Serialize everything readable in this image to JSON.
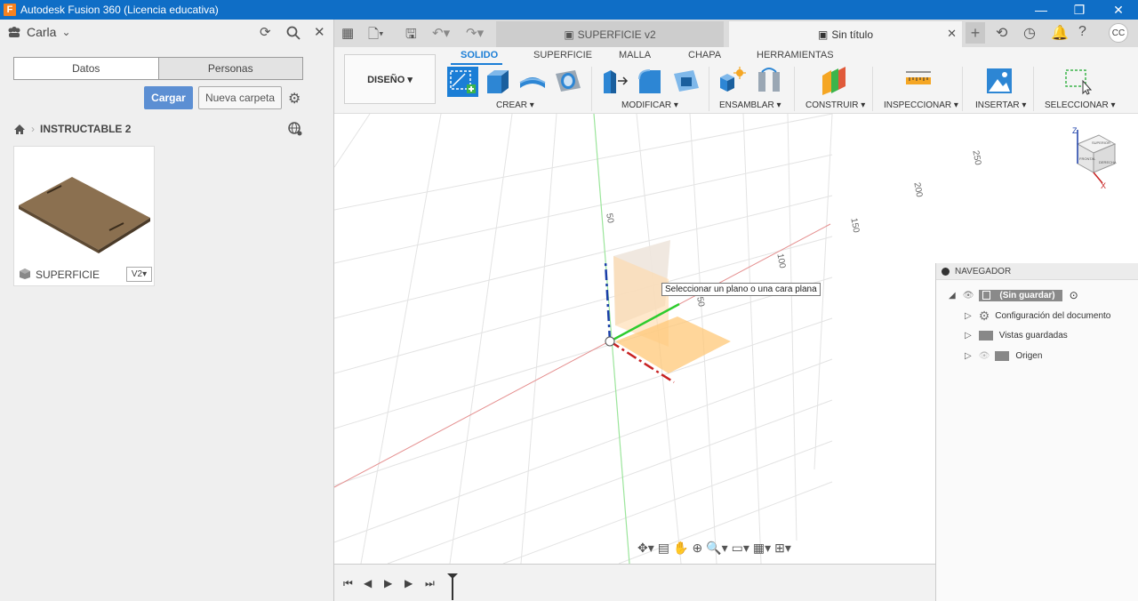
{
  "window": {
    "title": "Autodesk Fusion 360 (Licencia educativa)",
    "minimize": "—",
    "restore": "❐",
    "close": "✕"
  },
  "left_panel": {
    "user": "Carla",
    "tabs": {
      "data": "Datos",
      "people": "Personas"
    },
    "upload_label": "Cargar",
    "new_folder_label": "Nueva carpeta",
    "breadcrumb": "INSTRUCTABLE 2",
    "card": {
      "name": "SUPERFICIE",
      "version": "V2▾"
    }
  },
  "doc_tabs": [
    {
      "label": "SUPERFICIE v2"
    },
    {
      "label": "Sin título"
    }
  ],
  "avatar_initials": "CC",
  "ribbon": {
    "workspace": "DISEÑO ▾",
    "tabs": [
      "SOLIDO",
      "SUPERFICIE",
      "MALLA",
      "CHAPA",
      "HERRAMIENTAS"
    ],
    "groups": [
      "CREAR ▾",
      "MODIFICAR ▾",
      "ENSAMBLAR ▾",
      "CONSTRUIR ▾",
      "INSPECCIONAR ▾",
      "INSERTAR ▾",
      "SELECCIONAR ▾"
    ]
  },
  "viewport": {
    "tooltip": "Seleccionar un plano o una cara plana",
    "grid_labels": [
      "50",
      "100",
      "50",
      "150",
      "200",
      "250"
    ],
    "viewcube": {
      "front": "FRONTAL",
      "right": "DERECHA",
      "top": "SUPERIOR",
      "axis_z": "Z",
      "axis_x": "X"
    }
  },
  "navigator": {
    "title": "NAVEGADOR",
    "root": "(Sin guardar)",
    "items": [
      {
        "label": "Configuración del documento"
      },
      {
        "label": "Vistas guardadas"
      },
      {
        "label": "Origen"
      }
    ]
  },
  "colors": {
    "titlebar": "#0f6ec6",
    "accent": "#1b7ed6",
    "upload": "#5c8fd3",
    "plane": "#ffc878"
  }
}
